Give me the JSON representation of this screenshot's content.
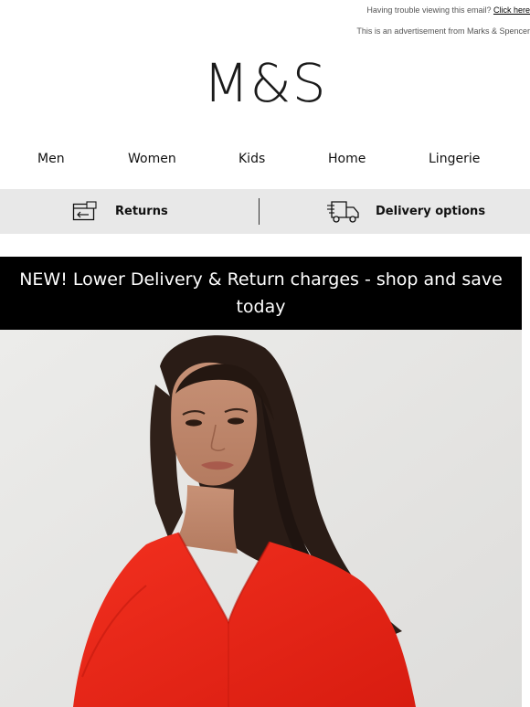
{
  "preheader": {
    "trouble_text": "Having trouble viewing this email? ",
    "trouble_link": "Click here",
    "ad_text": "This is an advertisement from Marks & Spencer"
  },
  "brand": {
    "logo": "M&S"
  },
  "nav": {
    "items": [
      {
        "label": "Men"
      },
      {
        "label": "Women"
      },
      {
        "label": "Kids"
      },
      {
        "label": "Home"
      },
      {
        "label": "Lingerie"
      }
    ]
  },
  "service_bar": {
    "returns_label": "Returns",
    "returns_icon": "returns-card-icon",
    "delivery_label": "Delivery options",
    "delivery_icon": "delivery-truck-icon",
    "background": "#e8e8e8"
  },
  "promo_banner": {
    "text": "NEW! Lower Delivery & Return charges - shop and save today",
    "background": "#000000",
    "color": "#ffffff"
  },
  "hero": {
    "background": "#e9e9e7",
    "garment_color": "#ee2616"
  }
}
